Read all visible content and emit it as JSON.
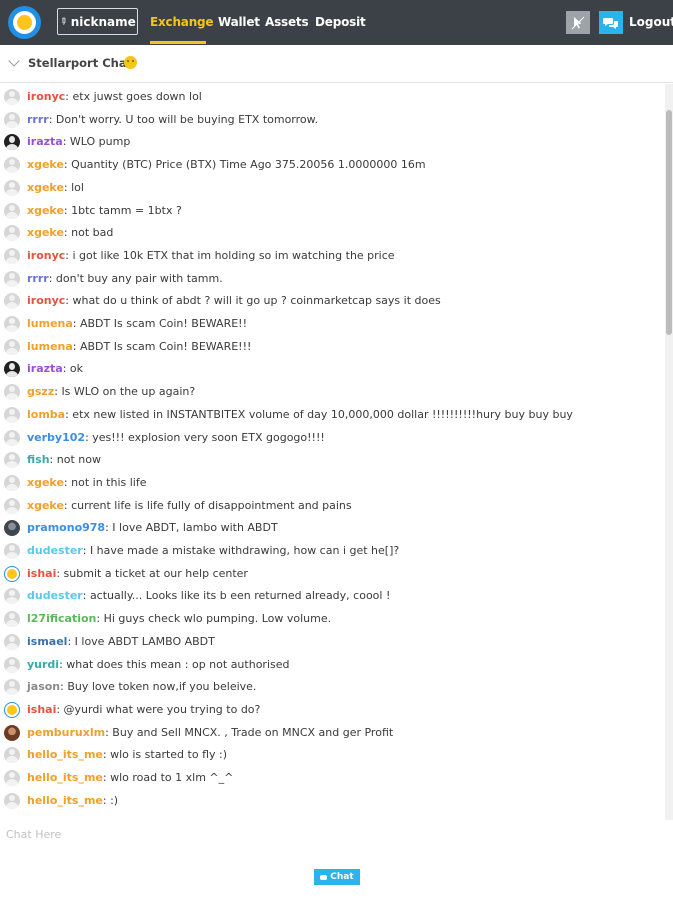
{
  "nav": {
    "nickname_label": "nickname",
    "links": [
      "Exchange",
      "Wallet",
      "Assets",
      "Deposit"
    ],
    "logout_label": "Logout",
    "colors": {
      "bar": "#3b4146",
      "active": "#f5c518",
      "accent": "#2bb3ec"
    }
  },
  "chat": {
    "title": "Stellarport Chat",
    "input_placeholder": "Chat Here",
    "send_label": "Chat",
    "messages": [
      {
        "user": "ironyc",
        "color": "#e5533d",
        "avatar": "default",
        "text": "etx juwst goes down lol"
      },
      {
        "user": "rrrr",
        "color": "#6a72d6",
        "avatar": "default",
        "text": "Don't worry. U too will be buying ETX tomorrow."
      },
      {
        "user": "irazta",
        "color": "#9b4fd6",
        "avatar": "dark",
        "text": "WLO pump"
      },
      {
        "user": "xgeke",
        "color": "#f0a02a",
        "avatar": "default",
        "text": "Quantity (BTC) Price (BTX) Time Ago 375.20056 1.0000000 16m"
      },
      {
        "user": "xgeke",
        "color": "#f0a02a",
        "avatar": "default",
        "text": "lol"
      },
      {
        "user": "xgeke",
        "color": "#f0a02a",
        "avatar": "default",
        "text": "1btc tamm = 1btx ?"
      },
      {
        "user": "xgeke",
        "color": "#f0a02a",
        "avatar": "default",
        "text": "not bad"
      },
      {
        "user": "ironyc",
        "color": "#e5533d",
        "avatar": "default",
        "text": "i got like 10k ETX that im holding so im watching the price"
      },
      {
        "user": "rrrr",
        "color": "#6a72d6",
        "avatar": "default",
        "text": "don't buy any pair with tamm."
      },
      {
        "user": "ironyc",
        "color": "#e5533d",
        "avatar": "default",
        "text": "what do u think of abdt ? will it go up ? coinmarketcap says it does"
      },
      {
        "user": "lumena",
        "color": "#f0a02a",
        "avatar": "default",
        "text": "ABDT Is scam Coin! BEWARE!!"
      },
      {
        "user": "lumena",
        "color": "#f0a02a",
        "avatar": "default",
        "text": "ABDT Is scam Coin! BEWARE!!!"
      },
      {
        "user": "irazta",
        "color": "#9b4fd6",
        "avatar": "dark",
        "text": "ok"
      },
      {
        "user": "gszz",
        "color": "#f0a02a",
        "avatar": "default",
        "text": "Is WLO on the up again?"
      },
      {
        "user": "lomba",
        "color": "#f0a02a",
        "avatar": "default",
        "text": "etx new listed in INSTANTBITEX volume of day 10,000,000 dollar !!!!!!!!!!hury buy buy buy"
      },
      {
        "user": "verby102",
        "color": "#3a8ee6",
        "avatar": "default",
        "text": "yes!!! explosion very soon ETX gogogo!!!!"
      },
      {
        "user": "fish",
        "color": "#3aa9a9",
        "avatar": "default",
        "text": "not now"
      },
      {
        "user": "xgeke",
        "color": "#f0a02a",
        "avatar": "default",
        "text": "not in this life"
      },
      {
        "user": "xgeke",
        "color": "#f0a02a",
        "avatar": "default",
        "text": "current life is life fully of disappointment and pains"
      },
      {
        "user": "pramono978",
        "color": "#3a8ee6",
        "avatar": "photo1",
        "text": "I love ABDT, lambo with ABDT"
      },
      {
        "user": "dudester",
        "color": "#5bc8e8",
        "avatar": "default",
        "text": "I have made a mistake withdrawing, how can i get he[]?"
      },
      {
        "user": "ishai",
        "color": "#e5533d",
        "avatar": "logo",
        "text": "submit a ticket at our help center"
      },
      {
        "user": "dudester",
        "color": "#5bc8e8",
        "avatar": "default",
        "text": "actually... Looks like its b een returned already, coool !"
      },
      {
        "user": "l27ification",
        "color": "#5cb85c",
        "avatar": "default",
        "text": "Hi guys check wlo pumping. Low volume."
      },
      {
        "user": "ismael",
        "color": "#3a6fb0",
        "avatar": "default",
        "text": "I love ABDT LAMBO ABDT"
      },
      {
        "user": "yurdi",
        "color": "#3aa9a9",
        "avatar": "default",
        "text": "what does this mean : op not authorised"
      },
      {
        "user": "jason",
        "color": "#8a8a8a",
        "avatar": "default",
        "text": "Buy love token now,if you beleive."
      },
      {
        "user": "ishai",
        "color": "#e5533d",
        "avatar": "logo",
        "text": "@yurdi what were you trying to do?"
      },
      {
        "user": "pemburuxlm",
        "color": "#f0a02a",
        "avatar": "photo2",
        "text": "Buy and Sell MNCX. , Trade on MNCX and ger Profit"
      },
      {
        "user": "hello_its_me",
        "color": "#f0a02a",
        "avatar": "default",
        "text": "wlo is started to fly :)"
      },
      {
        "user": "hello_its_me",
        "color": "#f0a02a",
        "avatar": "default",
        "text": "wlo road to 1 xlm ^_^"
      },
      {
        "user": "hello_its_me",
        "color": "#f0a02a",
        "avatar": "default",
        "text": ":)"
      }
    ]
  }
}
